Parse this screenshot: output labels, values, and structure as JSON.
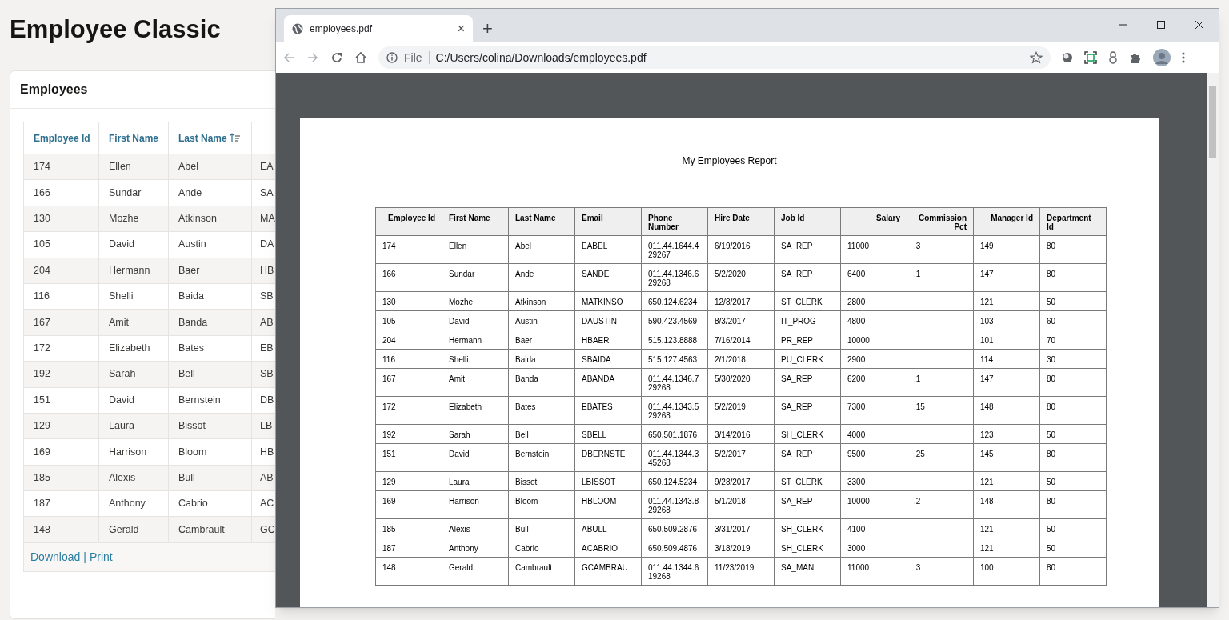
{
  "page_title": "Employee Classic",
  "card": {
    "title": "Employees",
    "table": {
      "columns": [
        {
          "label": "Employee Id",
          "sorted": false
        },
        {
          "label": "First Name",
          "sorted": false
        },
        {
          "label": "Last Name",
          "sorted": true
        }
      ],
      "rows": [
        [
          "174",
          "Ellen",
          "Abel",
          "EA"
        ],
        [
          "166",
          "Sundar",
          "Ande",
          "SA"
        ],
        [
          "130",
          "Mozhe",
          "Atkinson",
          "MA"
        ],
        [
          "105",
          "David",
          "Austin",
          "DA"
        ],
        [
          "204",
          "Hermann",
          "Baer",
          "HB"
        ],
        [
          "116",
          "Shelli",
          "Baida",
          "SB"
        ],
        [
          "167",
          "Amit",
          "Banda",
          "AB"
        ],
        [
          "172",
          "Elizabeth",
          "Bates",
          "EB"
        ],
        [
          "192",
          "Sarah",
          "Bell",
          "SB"
        ],
        [
          "151",
          "David",
          "Bernstein",
          "DB"
        ],
        [
          "129",
          "Laura",
          "Bissot",
          "LB"
        ],
        [
          "169",
          "Harrison",
          "Bloom",
          "HB"
        ],
        [
          "185",
          "Alexis",
          "Bull",
          "AB"
        ],
        [
          "187",
          "Anthony",
          "Cabrio",
          "AC"
        ],
        [
          "148",
          "Gerald",
          "Cambrault",
          "GC"
        ]
      ]
    },
    "links": [
      {
        "label": "Download"
      },
      {
        "label": "Print"
      }
    ],
    "link_separator": "|"
  },
  "browser": {
    "tab": {
      "title": "employees.pdf",
      "close": "×"
    },
    "new_tab": "+",
    "address": {
      "scheme": "File",
      "url": "C:/Users/colina/Downloads/employees.pdf"
    },
    "pdf": {
      "title": "My Employees Report",
      "columns": [
        "Employee Id",
        "First Name",
        "Last Name",
        "Email",
        "Phone Number",
        "Hire Date",
        "Job Id",
        "Salary",
        "Commission Pct",
        "Manager Id",
        "Department Id"
      ],
      "rows": [
        [
          "174",
          "Ellen",
          "Abel",
          "EABEL",
          "011.44.1644.429267",
          "6/19/2016",
          "SA_REP",
          "11000",
          ".3",
          "149",
          "80"
        ],
        [
          "166",
          "Sundar",
          "Ande",
          "SANDE",
          "011.44.1346.629268",
          "5/2/2020",
          "SA_REP",
          "6400",
          ".1",
          "147",
          "80"
        ],
        [
          "130",
          "Mozhe",
          "Atkinson",
          "MATKINSO",
          "650.124.6234",
          "12/8/2017",
          "ST_CLERK",
          "2800",
          "",
          "121",
          "50"
        ],
        [
          "105",
          "David",
          "Austin",
          "DAUSTIN",
          "590.423.4569",
          "8/3/2017",
          "IT_PROG",
          "4800",
          "",
          "103",
          "60"
        ],
        [
          "204",
          "Hermann",
          "Baer",
          "HBAER",
          "515.123.8888",
          "7/16/2014",
          "PR_REP",
          "10000",
          "",
          "101",
          "70"
        ],
        [
          "116",
          "Shelli",
          "Baida",
          "SBAIDA",
          "515.127.4563",
          "2/1/2018",
          "PU_CLERK",
          "2900",
          "",
          "114",
          "30"
        ],
        [
          "167",
          "Amit",
          "Banda",
          "ABANDA",
          "011.44.1346.729268",
          "5/30/2020",
          "SA_REP",
          "6200",
          ".1",
          "147",
          "80"
        ],
        [
          "172",
          "Elizabeth",
          "Bates",
          "EBATES",
          "011.44.1343.529268",
          "5/2/2019",
          "SA_REP",
          "7300",
          ".15",
          "148",
          "80"
        ],
        [
          "192",
          "Sarah",
          "Bell",
          "SBELL",
          "650.501.1876",
          "3/14/2016",
          "SH_CLERK",
          "4000",
          "",
          "123",
          "50"
        ],
        [
          "151",
          "David",
          "Bernstein",
          "DBERNSTE",
          "011.44.1344.345268",
          "5/2/2017",
          "SA_REP",
          "9500",
          ".25",
          "145",
          "80"
        ],
        [
          "129",
          "Laura",
          "Bissot",
          "LBISSOT",
          "650.124.5234",
          "9/28/2017",
          "ST_CLERK",
          "3300",
          "",
          "121",
          "50"
        ],
        [
          "169",
          "Harrison",
          "Bloom",
          "HBLOOM",
          "011.44.1343.829268",
          "5/1/2018",
          "SA_REP",
          "10000",
          ".2",
          "148",
          "80"
        ],
        [
          "185",
          "Alexis",
          "Bull",
          "ABULL",
          "650.509.2876",
          "3/31/2017",
          "SH_CLERK",
          "4100",
          "",
          "121",
          "50"
        ],
        [
          "187",
          "Anthony",
          "Cabrio",
          "ACABRIO",
          "650.509.4876",
          "3/18/2019",
          "SH_CLERK",
          "3000",
          "",
          "121",
          "50"
        ],
        [
          "148",
          "Gerald",
          "Cambrault",
          "GCAMBRAU",
          "011.44.1344.619268",
          "11/23/2019",
          "SA_MAN",
          "11000",
          ".3",
          "100",
          "80"
        ]
      ]
    }
  }
}
